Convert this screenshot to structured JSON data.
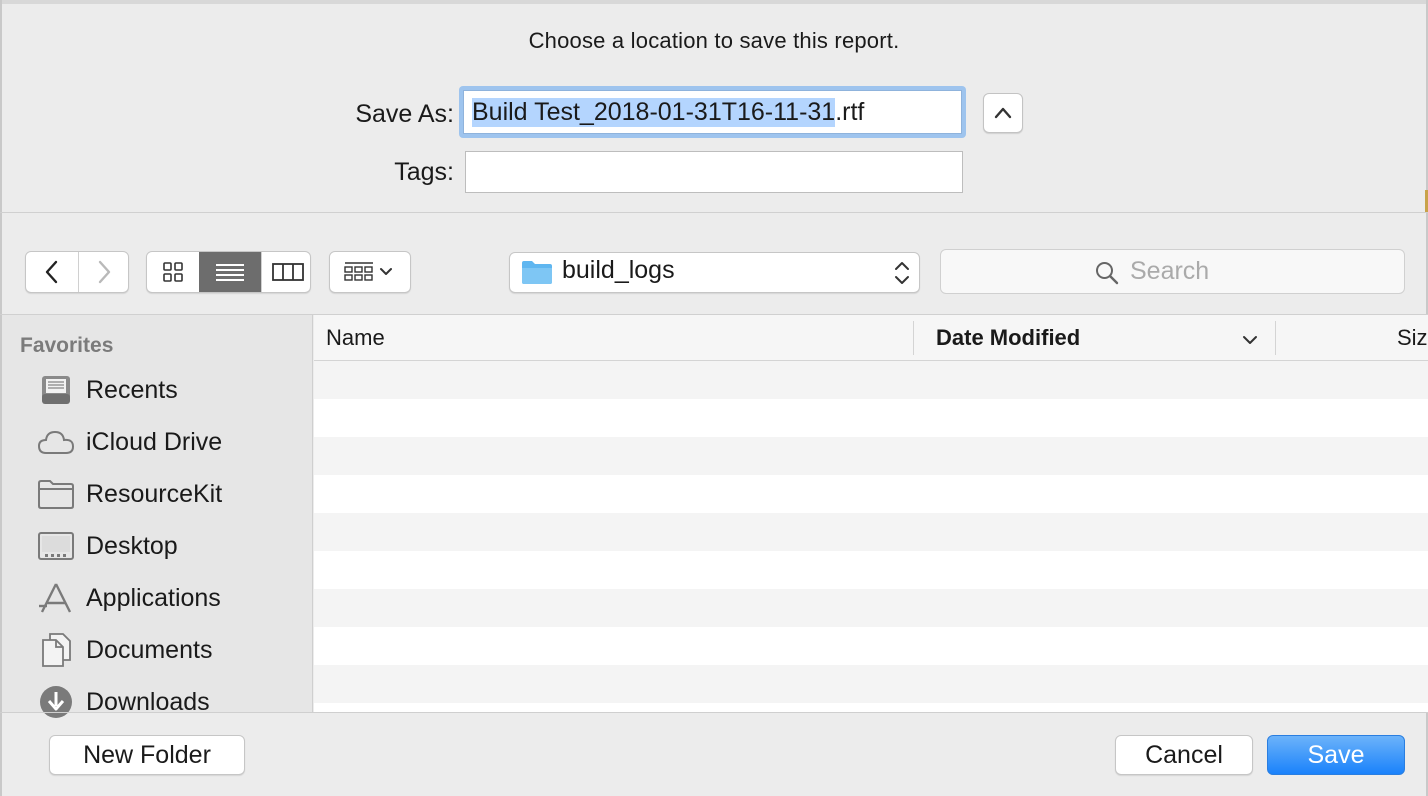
{
  "dialog": {
    "prompt": "Choose a location to save this report."
  },
  "save_as": {
    "label": "Save As:",
    "value_selected": "Build Test_2018-01-31T16-11-31",
    "value_ext": ".rtf",
    "expand_icon": "chevron-up-icon"
  },
  "tags": {
    "label": "Tags:",
    "value": ""
  },
  "toolbar": {
    "back_icon": "chevron-left-icon",
    "forward_icon": "chevron-right-icon",
    "view_modes": [
      "icon-view",
      "list-view",
      "column-view"
    ],
    "active_view": "list-view",
    "group_icon": "group-by-icon",
    "location": "build_logs",
    "search_placeholder": "Search"
  },
  "sidebar": {
    "heading": "Favorites",
    "items": [
      {
        "label": "Recents",
        "icon": "recents-icon"
      },
      {
        "label": "iCloud Drive",
        "icon": "cloud-icon"
      },
      {
        "label": "ResourceKit",
        "icon": "folder-icon"
      },
      {
        "label": "Desktop",
        "icon": "desktop-icon"
      },
      {
        "label": "Applications",
        "icon": "applications-icon"
      },
      {
        "label": "Documents",
        "icon": "documents-icon"
      },
      {
        "label": "Downloads",
        "icon": "downloads-icon"
      }
    ]
  },
  "file_list": {
    "columns": [
      "Name",
      "Date Modified",
      "Siz"
    ],
    "sort_column": "Date Modified",
    "rows": []
  },
  "buttons": {
    "new_folder": "New Folder",
    "cancel": "Cancel",
    "save": "Save"
  },
  "colors": {
    "accent": "#1a82fb",
    "selection": "#b4d5fe",
    "folder": "#5fb6f0"
  }
}
